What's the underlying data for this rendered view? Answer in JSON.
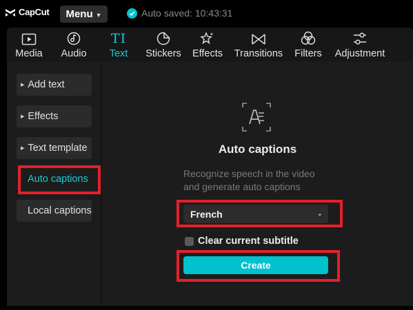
{
  "app": {
    "name": "CapCut"
  },
  "menu": {
    "label": "Menu"
  },
  "status": {
    "autosave": "Auto saved: 10:43:31"
  },
  "tabs": [
    {
      "label": "Media",
      "icon": "media-icon"
    },
    {
      "label": "Audio",
      "icon": "audio-icon"
    },
    {
      "label": "Text",
      "icon": "text-icon",
      "active": true
    },
    {
      "label": "Stickers",
      "icon": "stickers-icon"
    },
    {
      "label": "Effects",
      "icon": "effects-icon"
    },
    {
      "label": "Transitions",
      "icon": "transitions-icon"
    },
    {
      "label": "Filters",
      "icon": "filters-icon"
    },
    {
      "label": "Adjustment",
      "icon": "adjustment-icon"
    }
  ],
  "sidebar": {
    "items": [
      {
        "label": "Add text"
      },
      {
        "label": "Effects"
      },
      {
        "label": "Text template"
      },
      {
        "label": "Auto captions",
        "active": true
      },
      {
        "label": "Local captions"
      }
    ]
  },
  "auto_captions": {
    "title": "Auto captions",
    "description_line1": "Recognize speech in the video",
    "description_line2": "and generate auto captions",
    "language": "French",
    "clear_label": "Clear current subtitle",
    "clear_checked": false,
    "create_label": "Create"
  },
  "colors": {
    "accent": "#1ccbd6",
    "create_button": "#00c1cd",
    "highlight": "#e3212b",
    "panel": "#1c1c1c"
  }
}
